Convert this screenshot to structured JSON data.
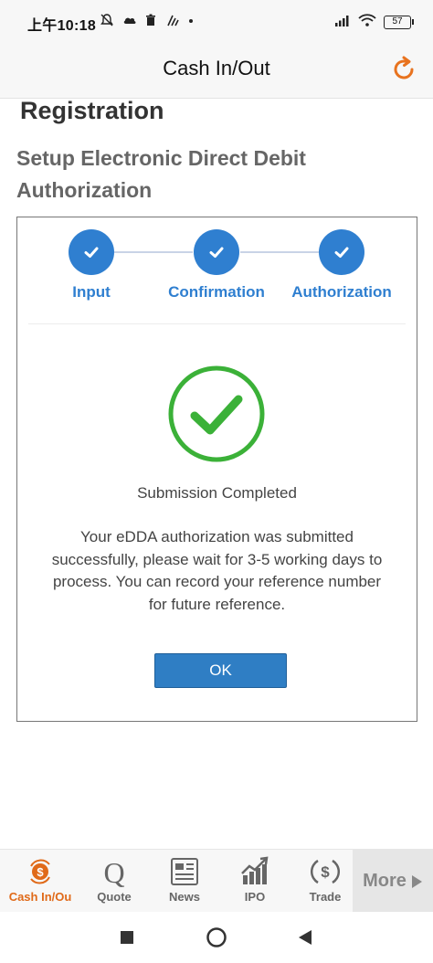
{
  "status_bar": {
    "time": "上午10:18",
    "battery": "57"
  },
  "header": {
    "title": "Cash In/Out"
  },
  "page": {
    "registration_title": "Registration",
    "setup_title": "Setup Electronic Direct Debit Authorization"
  },
  "steps": [
    {
      "label": "Input",
      "completed": true
    },
    {
      "label": "Confirmation",
      "completed": true
    },
    {
      "label": "Authorization",
      "completed": true
    }
  ],
  "result": {
    "title": "Submission Completed",
    "message": "Your eDDA authorization was submitted successfully, please wait for 3-5 working days to process. You can record your reference number for future reference.",
    "ok_label": "OK"
  },
  "bottom_nav": {
    "items": [
      {
        "label": "Cash In/Ou",
        "icon": "cash-in-out-icon",
        "active": true
      },
      {
        "label": "Quote",
        "icon": "quote-icon",
        "active": false
      },
      {
        "label": "News",
        "icon": "news-icon",
        "active": false
      },
      {
        "label": "IPO",
        "icon": "ipo-icon",
        "active": false
      },
      {
        "label": "Trade",
        "icon": "trade-icon",
        "active": false
      }
    ],
    "more_label": "More"
  },
  "colors": {
    "accent_blue": "#2f7fd0",
    "success_green": "#3bb138",
    "active_orange": "#e06a19"
  }
}
